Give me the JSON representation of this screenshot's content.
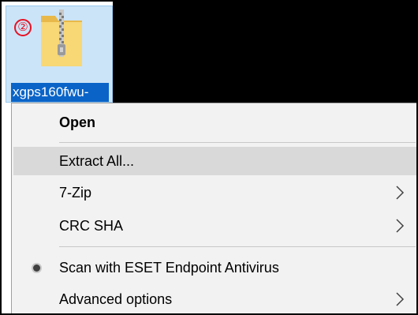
{
  "file": {
    "name": "xgps160fwu-",
    "step_badge": "②",
    "icon": "zip-folder-icon",
    "selection_color": "#cce4f7"
  },
  "context_menu": {
    "items": [
      {
        "label": "Open",
        "bold": true,
        "icon": null,
        "submenu": false
      },
      {
        "label": "Extract All...",
        "bold": false,
        "icon": null,
        "submenu": false,
        "highlighted": true
      },
      {
        "label": "7-Zip",
        "bold": false,
        "icon": null,
        "submenu": true
      },
      {
        "label": "CRC SHA",
        "bold": false,
        "icon": null,
        "submenu": true
      },
      {
        "label": "Scan with ESET Endpoint Antivirus",
        "bold": false,
        "icon": "eset-icon",
        "submenu": false
      },
      {
        "label": "Advanced options",
        "bold": false,
        "icon": null,
        "submenu": true
      }
    ],
    "highlight_color": "#d9d9d9",
    "background_color": "#f2f2f2"
  }
}
